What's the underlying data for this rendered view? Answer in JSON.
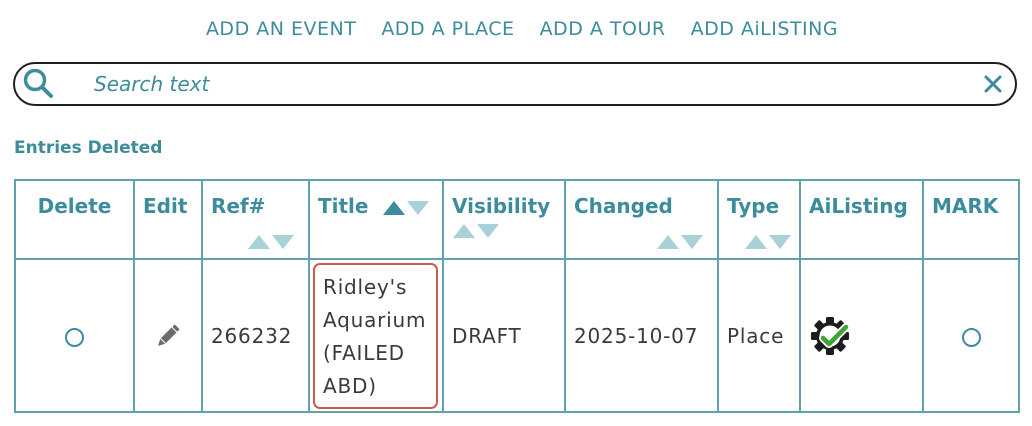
{
  "nav": [
    {
      "label": "ADD AN EVENT"
    },
    {
      "label": "ADD A PLACE"
    },
    {
      "label": "ADD A TOUR"
    },
    {
      "label": "ADD AiLISTING"
    }
  ],
  "search": {
    "placeholder": "Search text"
  },
  "section_title": "Entries Deleted",
  "table": {
    "headers": [
      "Delete",
      "Edit",
      "Ref#",
      "Title",
      "Visibility",
      "Changed",
      "Type",
      "AiListing",
      "MARK"
    ],
    "rows": [
      {
        "ref": "266232",
        "title": "Ridley's Aquarium (FAILED ABD)",
        "title_lines": [
          "Ridley's",
          "Aquarium",
          "(FAILED",
          "ABD)"
        ],
        "visibility": "DRAFT",
        "changed": "2025-10-07",
        "type": "Place"
      }
    ]
  },
  "colors": {
    "accent": "#3d8c9b",
    "highlight_border": "#cd5a4e",
    "check": "#3ea535"
  },
  "icons": [
    "search-icon",
    "clear-icon",
    "pencil-icon",
    "gear-check-icon",
    "sort-up-icon",
    "sort-down-icon"
  ]
}
